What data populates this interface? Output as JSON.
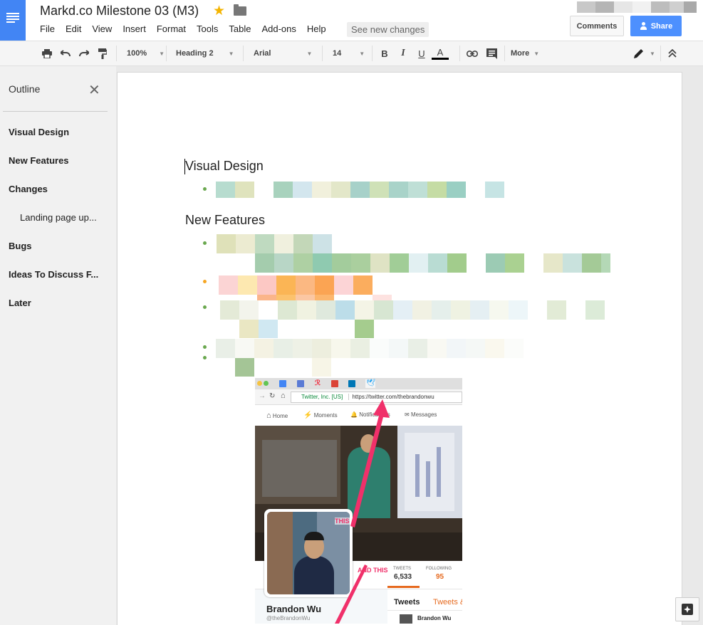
{
  "app": {
    "doc_title": "Markd.co Milestone 03 (M3)",
    "menu": [
      "File",
      "Edit",
      "View",
      "Insert",
      "Format",
      "Tools",
      "Table",
      "Add-ons",
      "Help"
    ],
    "see_new_changes": "See new changes",
    "comments_label": "Comments",
    "share_label": "Share",
    "brand_color": "#4285f4"
  },
  "toolbar": {
    "zoom": "100%",
    "style": "Heading 2",
    "font": "Arial",
    "size": "14",
    "bold": "B",
    "italic": "I",
    "underline": "U",
    "text_color": "A",
    "more": "More"
  },
  "outline": {
    "title": "Outline",
    "items": [
      "Visual Design",
      "New Features",
      "Changes",
      "Landing page up...",
      "Bugs",
      "Ideas To Discuss F...",
      "Later"
    ]
  },
  "document": {
    "headings": [
      "Visual Design",
      "New Features"
    ]
  },
  "screenshot": {
    "url_secure": "Twitter, Inc. [US]",
    "url": "https://twitter.com/thebrandonwu",
    "nav": [
      "Home",
      "Moments",
      "Notifications",
      "Messages"
    ],
    "annotation_1": "THIS",
    "annotation_2": "AND THIS",
    "tweets_label": "TWEETS",
    "tweets_count": "6,533",
    "following_label": "FOLLOWING",
    "following_count": "95",
    "profile_name": "Brandon Wu",
    "profile_handle": "@theBrandonWu",
    "tab_tweets": "Tweets",
    "tab_tweets_replies": "Tweets &",
    "tweet_author": "Brandon Wu"
  }
}
